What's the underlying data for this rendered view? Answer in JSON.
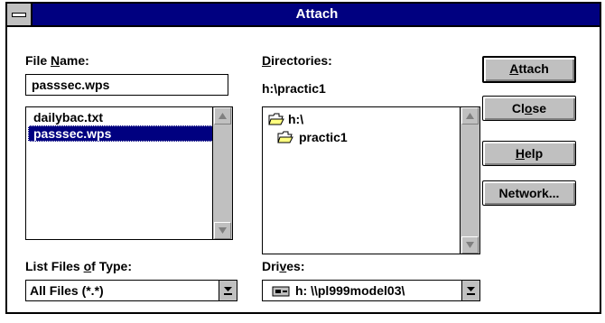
{
  "window": {
    "title": "Attach"
  },
  "file_name": {
    "label": "File Name:",
    "value": "passsec.wps"
  },
  "files": [
    {
      "name": "dailybac.txt",
      "selected": false
    },
    {
      "name": "passsec.wps",
      "selected": true
    }
  ],
  "directories": {
    "label": "Directories:",
    "current": "h:\\practic1",
    "items": [
      "h:\\",
      "practic1"
    ]
  },
  "file_types": {
    "label": "List Files of Type:",
    "value": "All Files (*.*)"
  },
  "drives": {
    "label": "Drives:",
    "value": "h: \\\\pl999model03\\"
  },
  "buttons": {
    "attach": "Attach",
    "close": "Close",
    "help": "Help",
    "network": "Network..."
  }
}
